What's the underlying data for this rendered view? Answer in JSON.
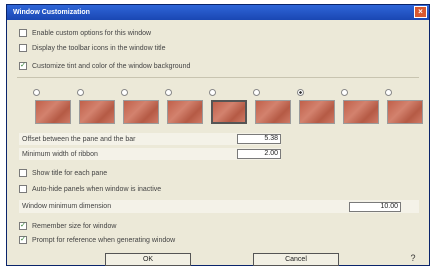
{
  "dialog": {
    "title": "Window Customization",
    "close_glyph": "×"
  },
  "checkboxes_top": [
    {
      "label": "Enable custom options for this window",
      "checked": false
    },
    {
      "label": "Display the toolbar icons in the window title",
      "checked": false
    },
    {
      "label": "Customize tint and color of the window background",
      "checked": true
    }
  ],
  "radios_selected_index": 6,
  "radio_count": 9,
  "swatch_count": 9,
  "swatch_selected_index": 4,
  "fields": {
    "offset_label": "Offset between the pane and the bar",
    "offset_value": "5.38",
    "width_label": "Minimum width of ribbon",
    "width_value": "2.00"
  },
  "checkboxes_mid": [
    {
      "label": "Show title for each pane",
      "checked": false
    },
    {
      "label": "Auto-hide panels when window is inactive",
      "checked": false
    }
  ],
  "min_size": {
    "label": "Window minimum dimension",
    "value": "10.00"
  },
  "checkboxes_bottom": [
    {
      "label": "Remember size for window",
      "checked": true
    },
    {
      "label": "Prompt for reference when generating window",
      "checked": true
    }
  ],
  "buttons": {
    "ok": "OK",
    "cancel": "Cancel",
    "help": "?"
  },
  "colors": {
    "titlebar": "#1a47b3",
    "face": "#ece9d8",
    "swatch": "#c0604a"
  }
}
